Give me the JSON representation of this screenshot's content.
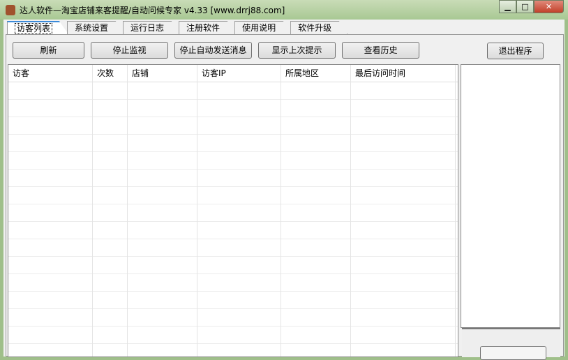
{
  "window": {
    "title": "达人软件—淘宝店铺来客提醒/自动问候专家 v4.33  [www.drrj88.com]"
  },
  "tabs": [
    {
      "label": "访客列表"
    },
    {
      "label": "系统设置"
    },
    {
      "label": "运行日志"
    },
    {
      "label": "注册软件"
    },
    {
      "label": "使用说明"
    },
    {
      "label": "软件升级"
    }
  ],
  "toolbar": {
    "refresh": "刷新",
    "stop_monitor": "停止监视",
    "stop_auto_send": "停止自动发送消息",
    "show_last": "显示上次提示",
    "history": "查看历史",
    "exit": "退出程序"
  },
  "table": {
    "columns": [
      "访客",
      "次数",
      "店铺",
      "访客IP",
      "所属地区",
      "最后访问时间"
    ],
    "rows": []
  }
}
